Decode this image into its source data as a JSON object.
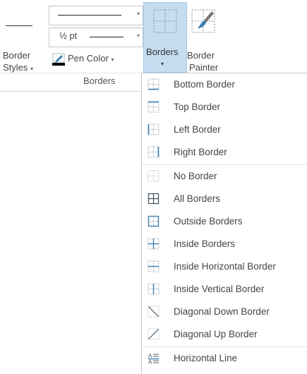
{
  "ribbon": {
    "border_styles": {
      "label_line1": "Border",
      "label_line2": "Styles",
      "caret": "▾"
    },
    "line_style": {
      "caret": "▾"
    },
    "line_weight": {
      "value": "½ pt",
      "caret": "▾"
    },
    "pen_color": {
      "label": "Pen Color",
      "caret": "▾",
      "swatch_color": "#000000"
    },
    "borders": {
      "label": "Borders",
      "caret": "▾"
    },
    "border_painter": {
      "label_line1": "Border",
      "label_line2": "Painter"
    },
    "group_label": "Borders"
  },
  "menu": {
    "items": [
      {
        "label": "Bottom Border",
        "icon": "bottom-border-icon"
      },
      {
        "label": "Top Border",
        "icon": "top-border-icon"
      },
      {
        "label": "Left Border",
        "icon": "left-border-icon"
      },
      {
        "label": "Right Border",
        "icon": "right-border-icon"
      },
      {
        "label": "No Border",
        "icon": "no-border-icon"
      },
      {
        "label": "All Borders",
        "icon": "all-borders-icon"
      },
      {
        "label": "Outside Borders",
        "icon": "outside-borders-icon"
      },
      {
        "label": "Inside Borders",
        "icon": "inside-borders-icon"
      },
      {
        "label": "Inside Horizontal Border",
        "icon": "inside-horizontal-border-icon"
      },
      {
        "label": "Inside Vertical Border",
        "icon": "inside-vertical-border-icon"
      },
      {
        "label": "Diagonal Down Border",
        "icon": "diagonal-down-border-icon"
      },
      {
        "label": "Diagonal Up Border",
        "icon": "diagonal-up-border-icon"
      },
      {
        "label": "Horizontal Line",
        "icon": "horizontal-line-icon"
      }
    ]
  },
  "colors": {
    "active_button_bg": "#c5dcf1",
    "icon_blue": "#3c7fb1",
    "text": "#444444"
  }
}
